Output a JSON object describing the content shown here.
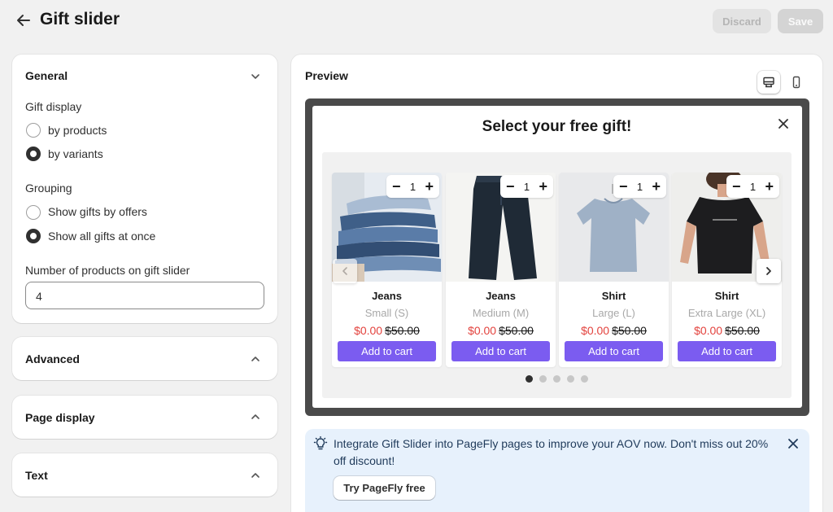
{
  "header": {
    "title": "Gift slider",
    "discard_label": "Discard",
    "save_label": "Save"
  },
  "general": {
    "title": "General",
    "gift_display_label": "Gift display",
    "gift_display_options": [
      "by products",
      "by variants"
    ],
    "gift_display_selected": "by variants",
    "grouping_label": "Grouping",
    "grouping_options": [
      "Show gifts by offers",
      "Show all gifts at once"
    ],
    "grouping_selected": "Show all gifts at once",
    "num_products_label": "Number of products on gift slider",
    "num_products_value": "4"
  },
  "sections": {
    "advanced": "Advanced",
    "page_display": "Page display",
    "text": "Text"
  },
  "preview": {
    "title": "Preview",
    "device_selected": "desktop",
    "modal_title": "Select your free gift!",
    "products": [
      {
        "name": "Jeans",
        "variant": "Small (S)",
        "price": "$0.00",
        "original_price": "$50.00",
        "qty": "1",
        "add_label": "Add to cart"
      },
      {
        "name": "Jeans",
        "variant": "Medium (M)",
        "price": "$0.00",
        "original_price": "$50.00",
        "qty": "1",
        "add_label": "Add to cart"
      },
      {
        "name": "Shirt",
        "variant": "Large (L)",
        "price": "$0.00",
        "original_price": "$50.00",
        "qty": "1",
        "add_label": "Add to cart"
      },
      {
        "name": "Shirt",
        "variant": "Extra Large (XL)",
        "price": "$0.00",
        "original_price": "$50.00",
        "qty": "1",
        "add_label": "Add to cart"
      }
    ],
    "pagination": {
      "pages": 5,
      "active": 1
    }
  },
  "banner": {
    "text": "Integrate Gift Slider into PageFly pages to improve your AOV now. Don't miss out 20% off discount!",
    "button_label": "Try PageFly free"
  },
  "colors": {
    "accent": "#7b5cf0",
    "sale": "#e3423d",
    "banner_bg": "#e7f1fc"
  }
}
